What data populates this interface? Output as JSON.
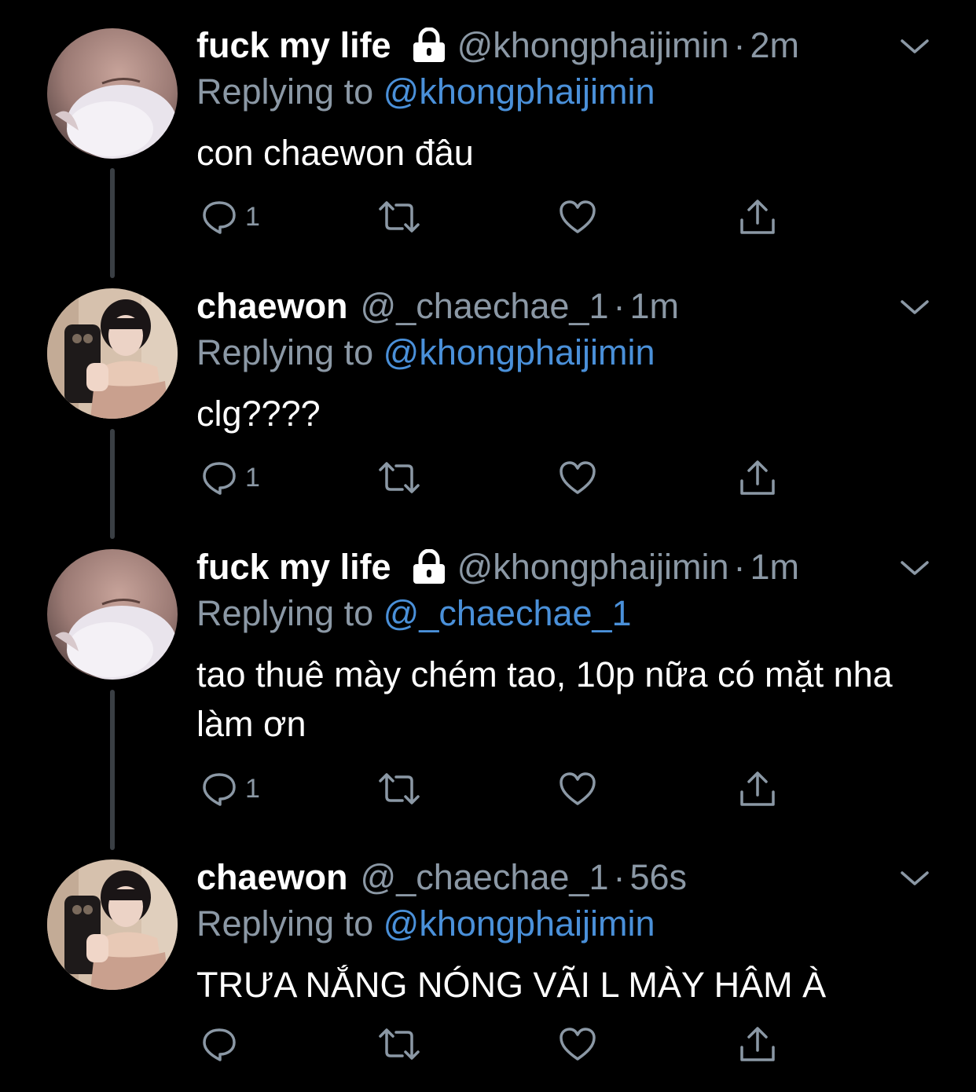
{
  "tweets": [
    {
      "display_name": "fuck my life",
      "locked": true,
      "handle": "@khongphaijimin",
      "separator": "·",
      "time": "2m",
      "replying_prefix": "Replying to",
      "replying_to": "@khongphaijimin",
      "text": "con chaewon đâu",
      "reply_count": "1",
      "avatar": "sleeping-girl-avatar"
    },
    {
      "display_name": "chaewon",
      "locked": false,
      "handle": "@_chaechae_1",
      "separator": "·",
      "time": "1m",
      "replying_prefix": "Replying to",
      "replying_to": "@khongphaijimin",
      "text": "clg????",
      "reply_count": "1",
      "avatar": "mirror-selfie-avatar"
    },
    {
      "display_name": "fuck my life",
      "locked": true,
      "handle": "@khongphaijimin",
      "separator": "·",
      "time": "1m",
      "replying_prefix": "Replying to",
      "replying_to": "@_chaechae_1",
      "text": "tao thuê mày chém tao, 10p nữa có mặt nha làm ơn",
      "reply_count": "1",
      "avatar": "sleeping-girl-avatar"
    },
    {
      "display_name": "chaewon",
      "locked": false,
      "handle": "@_chaechae_1",
      "separator": "·",
      "time": "56s",
      "replying_prefix": "Replying to",
      "replying_to": "@khongphaijimin",
      "text": "TRƯA NẮNG NÓNG VÃI L MÀY HÂM À",
      "reply_count": "",
      "avatar": "mirror-selfie-avatar"
    }
  ],
  "colors": {
    "background": "#000000",
    "text": "#ffffff",
    "secondary": "#8b98a5",
    "link": "#4a90d9",
    "thread_line": "#3a3f44"
  },
  "icons": {
    "reply": "reply-icon",
    "retweet": "retweet-icon",
    "like": "heart-icon",
    "share": "share-icon",
    "lock": "lock-icon",
    "more": "chevron-down-icon"
  }
}
